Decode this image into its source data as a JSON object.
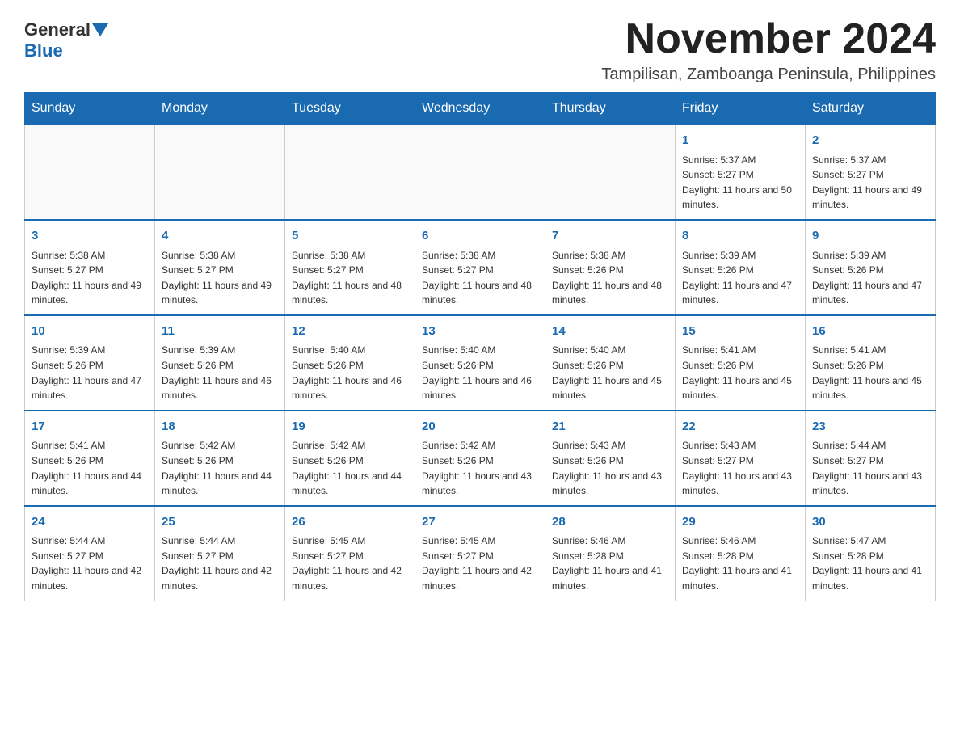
{
  "header": {
    "logo_general": "General",
    "logo_blue": "Blue",
    "month_title": "November 2024",
    "subtitle": "Tampilisan, Zamboanga Peninsula, Philippines"
  },
  "days_of_week": [
    "Sunday",
    "Monday",
    "Tuesday",
    "Wednesday",
    "Thursday",
    "Friday",
    "Saturday"
  ],
  "weeks": [
    [
      {
        "day": "",
        "sunrise": "",
        "sunset": "",
        "daylight": ""
      },
      {
        "day": "",
        "sunrise": "",
        "sunset": "",
        "daylight": ""
      },
      {
        "day": "",
        "sunrise": "",
        "sunset": "",
        "daylight": ""
      },
      {
        "day": "",
        "sunrise": "",
        "sunset": "",
        "daylight": ""
      },
      {
        "day": "",
        "sunrise": "",
        "sunset": "",
        "daylight": ""
      },
      {
        "day": "1",
        "sunrise": "Sunrise: 5:37 AM",
        "sunset": "Sunset: 5:27 PM",
        "daylight": "Daylight: 11 hours and 50 minutes."
      },
      {
        "day": "2",
        "sunrise": "Sunrise: 5:37 AM",
        "sunset": "Sunset: 5:27 PM",
        "daylight": "Daylight: 11 hours and 49 minutes."
      }
    ],
    [
      {
        "day": "3",
        "sunrise": "Sunrise: 5:38 AM",
        "sunset": "Sunset: 5:27 PM",
        "daylight": "Daylight: 11 hours and 49 minutes."
      },
      {
        "day": "4",
        "sunrise": "Sunrise: 5:38 AM",
        "sunset": "Sunset: 5:27 PM",
        "daylight": "Daylight: 11 hours and 49 minutes."
      },
      {
        "day": "5",
        "sunrise": "Sunrise: 5:38 AM",
        "sunset": "Sunset: 5:27 PM",
        "daylight": "Daylight: 11 hours and 48 minutes."
      },
      {
        "day": "6",
        "sunrise": "Sunrise: 5:38 AM",
        "sunset": "Sunset: 5:27 PM",
        "daylight": "Daylight: 11 hours and 48 minutes."
      },
      {
        "day": "7",
        "sunrise": "Sunrise: 5:38 AM",
        "sunset": "Sunset: 5:26 PM",
        "daylight": "Daylight: 11 hours and 48 minutes."
      },
      {
        "day": "8",
        "sunrise": "Sunrise: 5:39 AM",
        "sunset": "Sunset: 5:26 PM",
        "daylight": "Daylight: 11 hours and 47 minutes."
      },
      {
        "day": "9",
        "sunrise": "Sunrise: 5:39 AM",
        "sunset": "Sunset: 5:26 PM",
        "daylight": "Daylight: 11 hours and 47 minutes."
      }
    ],
    [
      {
        "day": "10",
        "sunrise": "Sunrise: 5:39 AM",
        "sunset": "Sunset: 5:26 PM",
        "daylight": "Daylight: 11 hours and 47 minutes."
      },
      {
        "day": "11",
        "sunrise": "Sunrise: 5:39 AM",
        "sunset": "Sunset: 5:26 PM",
        "daylight": "Daylight: 11 hours and 46 minutes."
      },
      {
        "day": "12",
        "sunrise": "Sunrise: 5:40 AM",
        "sunset": "Sunset: 5:26 PM",
        "daylight": "Daylight: 11 hours and 46 minutes."
      },
      {
        "day": "13",
        "sunrise": "Sunrise: 5:40 AM",
        "sunset": "Sunset: 5:26 PM",
        "daylight": "Daylight: 11 hours and 46 minutes."
      },
      {
        "day": "14",
        "sunrise": "Sunrise: 5:40 AM",
        "sunset": "Sunset: 5:26 PM",
        "daylight": "Daylight: 11 hours and 45 minutes."
      },
      {
        "day": "15",
        "sunrise": "Sunrise: 5:41 AM",
        "sunset": "Sunset: 5:26 PM",
        "daylight": "Daylight: 11 hours and 45 minutes."
      },
      {
        "day": "16",
        "sunrise": "Sunrise: 5:41 AM",
        "sunset": "Sunset: 5:26 PM",
        "daylight": "Daylight: 11 hours and 45 minutes."
      }
    ],
    [
      {
        "day": "17",
        "sunrise": "Sunrise: 5:41 AM",
        "sunset": "Sunset: 5:26 PM",
        "daylight": "Daylight: 11 hours and 44 minutes."
      },
      {
        "day": "18",
        "sunrise": "Sunrise: 5:42 AM",
        "sunset": "Sunset: 5:26 PM",
        "daylight": "Daylight: 11 hours and 44 minutes."
      },
      {
        "day": "19",
        "sunrise": "Sunrise: 5:42 AM",
        "sunset": "Sunset: 5:26 PM",
        "daylight": "Daylight: 11 hours and 44 minutes."
      },
      {
        "day": "20",
        "sunrise": "Sunrise: 5:42 AM",
        "sunset": "Sunset: 5:26 PM",
        "daylight": "Daylight: 11 hours and 43 minutes."
      },
      {
        "day": "21",
        "sunrise": "Sunrise: 5:43 AM",
        "sunset": "Sunset: 5:26 PM",
        "daylight": "Daylight: 11 hours and 43 minutes."
      },
      {
        "day": "22",
        "sunrise": "Sunrise: 5:43 AM",
        "sunset": "Sunset: 5:27 PM",
        "daylight": "Daylight: 11 hours and 43 minutes."
      },
      {
        "day": "23",
        "sunrise": "Sunrise: 5:44 AM",
        "sunset": "Sunset: 5:27 PM",
        "daylight": "Daylight: 11 hours and 43 minutes."
      }
    ],
    [
      {
        "day": "24",
        "sunrise": "Sunrise: 5:44 AM",
        "sunset": "Sunset: 5:27 PM",
        "daylight": "Daylight: 11 hours and 42 minutes."
      },
      {
        "day": "25",
        "sunrise": "Sunrise: 5:44 AM",
        "sunset": "Sunset: 5:27 PM",
        "daylight": "Daylight: 11 hours and 42 minutes."
      },
      {
        "day": "26",
        "sunrise": "Sunrise: 5:45 AM",
        "sunset": "Sunset: 5:27 PM",
        "daylight": "Daylight: 11 hours and 42 minutes."
      },
      {
        "day": "27",
        "sunrise": "Sunrise: 5:45 AM",
        "sunset": "Sunset: 5:27 PM",
        "daylight": "Daylight: 11 hours and 42 minutes."
      },
      {
        "day": "28",
        "sunrise": "Sunrise: 5:46 AM",
        "sunset": "Sunset: 5:28 PM",
        "daylight": "Daylight: 11 hours and 41 minutes."
      },
      {
        "day": "29",
        "sunrise": "Sunrise: 5:46 AM",
        "sunset": "Sunset: 5:28 PM",
        "daylight": "Daylight: 11 hours and 41 minutes."
      },
      {
        "day": "30",
        "sunrise": "Sunrise: 5:47 AM",
        "sunset": "Sunset: 5:28 PM",
        "daylight": "Daylight: 11 hours and 41 minutes."
      }
    ]
  ]
}
